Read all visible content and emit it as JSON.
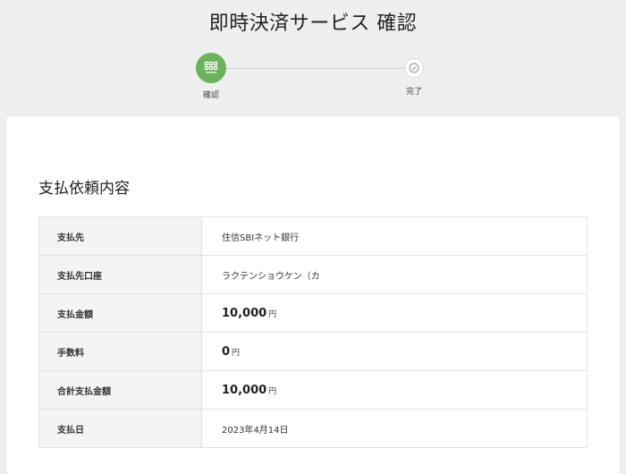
{
  "header": {
    "title": "即時決済サービス 確認"
  },
  "stepper": {
    "steps": [
      {
        "label": "確認",
        "state": "active",
        "icon": "grid-icon"
      },
      {
        "label": "完了",
        "state": "pending",
        "icon": "check-icon"
      }
    ],
    "active_color": "#6db35c"
  },
  "details": {
    "title": "支払依頼内容",
    "rows": [
      {
        "label": "支払先",
        "value": "住信SBIネット銀行"
      },
      {
        "label": "支払先口座",
        "value": "ラクテンショウケン（カ"
      },
      {
        "label": "支払金額",
        "amount": "10,000",
        "unit": "円"
      },
      {
        "label": "手数料",
        "amount": "0",
        "unit": "円"
      },
      {
        "label": "合計支払金額",
        "amount": "10,000",
        "unit": "円"
      },
      {
        "label": "支払日",
        "value": "2023年4月14日"
      }
    ]
  }
}
